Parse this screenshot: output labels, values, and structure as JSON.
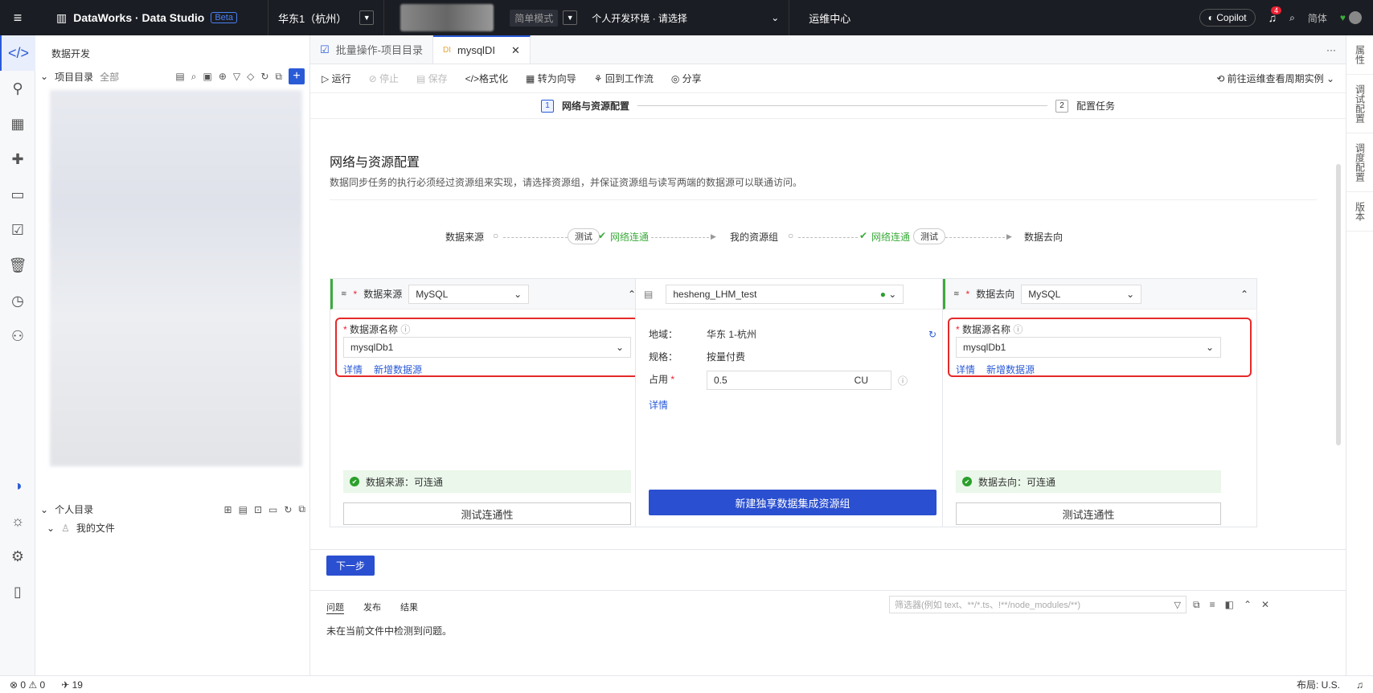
{
  "topbar": {
    "brand": "DataWorks · Data Studio",
    "beta": "Beta",
    "region": "华东1（杭州）",
    "mode": "简单模式",
    "env": "个人开发环境 · 请选择",
    "ops": "运维中心",
    "copilot": "Copilot",
    "notifications": "4",
    "lang": "简体"
  },
  "sidebar": {
    "title": "数据开发",
    "project_dir": "项目目录",
    "all": "全部",
    "personal_dir": "个人目录",
    "my_files": "我的文件"
  },
  "tabs": [
    {
      "label": "批量操作-项目目录"
    },
    {
      "label": "mysqlDI"
    }
  ],
  "toolbar": {
    "run": "运行",
    "stop": "停止",
    "save": "保存",
    "format": "格式化",
    "to_wizard": "转为向导",
    "back_workflow": "回到工作流",
    "share": "分享",
    "goto_ops": "前往运维查看周期实例"
  },
  "stepper": {
    "step1_num": "1",
    "step1": "网络与资源配置",
    "step2_num": "2",
    "step2": "配置任务"
  },
  "section": {
    "title": "网络与资源配置",
    "desc": "数据同步任务的执行必须经过资源组来实现，请选择资源组，并保证资源组与读写两端的数据源可以联通访问。"
  },
  "flow": {
    "source": "数据来源",
    "test1": "测试",
    "net1": "网络连通",
    "my_group": "我的资源组",
    "net2": "网络连通",
    "test2": "测试",
    "target": "数据去向"
  },
  "source_card": {
    "label": "数据来源",
    "type": "MySQL",
    "name_label": "数据源名称",
    "name_value": "mysqlDb1",
    "detail": "详情",
    "add": "新增数据源",
    "status": "数据来源：可连通",
    "test_btn": "测试连通性"
  },
  "group_card": {
    "name": "hesheng_LHM_test",
    "region_label": "地域：",
    "region_value": "华东 1-杭州",
    "spec_label": "规格：",
    "spec_value": "按量付费",
    "usage_label": "占用",
    "usage_value": "0.5",
    "unit": "CU",
    "detail": "详情",
    "create_btn": "新建独享数据集成资源组"
  },
  "target_card": {
    "label": "数据去向",
    "type": "MySQL",
    "name_label": "数据源名称",
    "name_value": "mysqlDb1",
    "detail": "详情",
    "add": "新增数据源",
    "status": "数据去向：可连通",
    "test_btn": "测试连通性"
  },
  "next": "下一步",
  "panel": {
    "tab_problems": "问题",
    "tab_publish": "发布",
    "tab_results": "结果",
    "filter_placeholder": "筛选器(例如 text、**/*.ts、!**/node_modules/**)",
    "message": "未在当前文件中检测到问题。"
  },
  "rightbar": [
    "属性",
    "调试配置",
    "调度配置",
    "版本"
  ],
  "status": {
    "errors": "0",
    "warnings": "0",
    "count": "19",
    "layout": "布局: U.S."
  }
}
